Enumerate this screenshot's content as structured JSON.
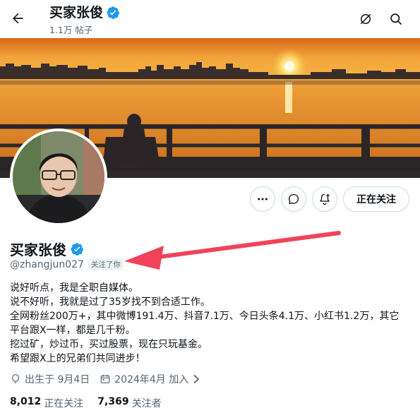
{
  "header": {
    "title": "买家张俊",
    "post_count": "1.1万 帖子",
    "back_icon": "arrow-left-icon",
    "action_icons": [
      "grok-icon",
      "search-icon"
    ]
  },
  "banner": {
    "icon": "sunset-lake-photo"
  },
  "profile": {
    "name": "买家张俊",
    "handle": "@zhangjun027",
    "follows_you": "关注了你",
    "verified_color": "#1d9bf0",
    "bio_lines": [
      "说好听点，我是全职自媒体。",
      "说不好听，我就是过了35岁找不到合适工作。",
      "全网粉丝200万+，其中微博191.4万、抖音7.1万、今日头条4.1万、小红书1.2万，其它",
      "平台跟X一样，都是几千粉。",
      "挖过矿，炒过币，买过股票，现在只玩基金。",
      "希望跟X上的兄弟们共同进步！"
    ],
    "birthday": "出生于 9月4日",
    "joined": "2024年4月 加入",
    "following_count": "8,012",
    "following_label": "正在关注",
    "followers_count": "7,369",
    "followers_label": "关注者"
  },
  "actions": {
    "more_icon": "more-icon",
    "message_icon": "message-icon",
    "notify_icon": "bell-plus-icon",
    "follow_label": "正在关注"
  },
  "annotation": {
    "color": "#f0435a"
  }
}
